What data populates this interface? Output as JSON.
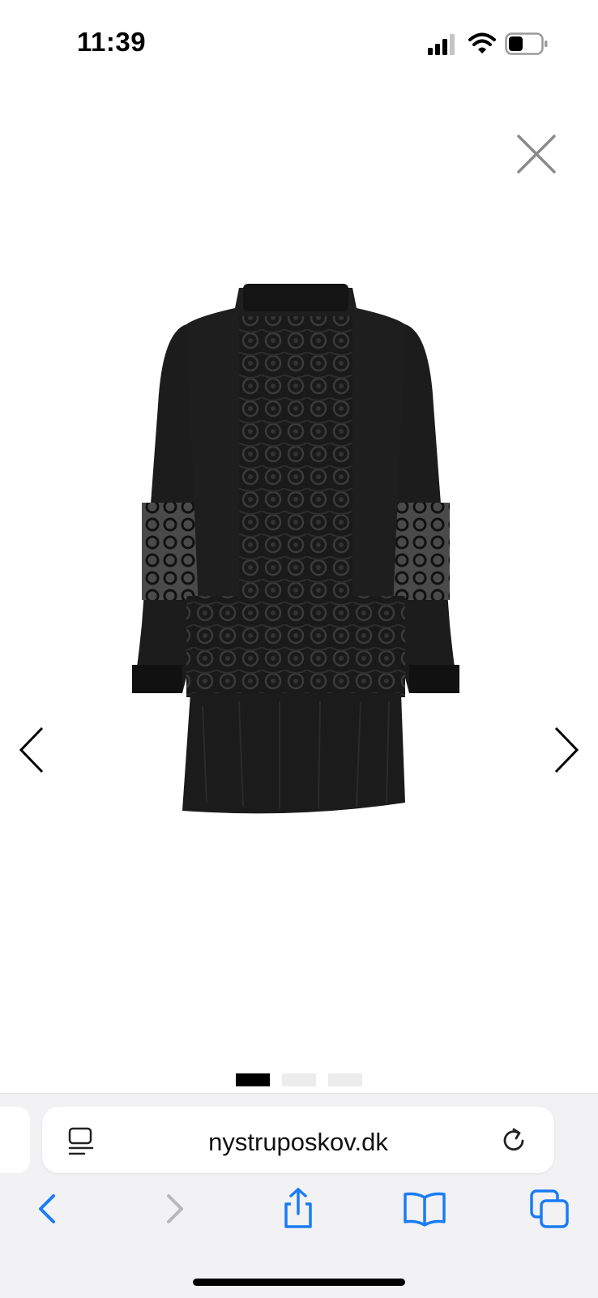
{
  "status_bar": {
    "time": "11:39",
    "signal_icon": "cellular-signal-icon",
    "wifi_icon": "wifi-icon",
    "battery_icon": "battery-icon"
  },
  "gallery": {
    "product_image": "black-lace-dress-image",
    "close_icon": "close-icon",
    "prev_icon": "chevron-left-icon",
    "next_icon": "chevron-right-icon",
    "page_count": 3,
    "active_page": 1
  },
  "browser": {
    "url": "nystruposkov.dk",
    "reader_icon": "page-menu-icon",
    "reload_icon": "reload-icon",
    "toolbar": [
      "back-icon",
      "forward-icon",
      "share-icon",
      "bookmarks-icon",
      "tabs-icon"
    ],
    "accent_color": "#1a7cf5",
    "disabled_color": "#b8b8bc"
  }
}
